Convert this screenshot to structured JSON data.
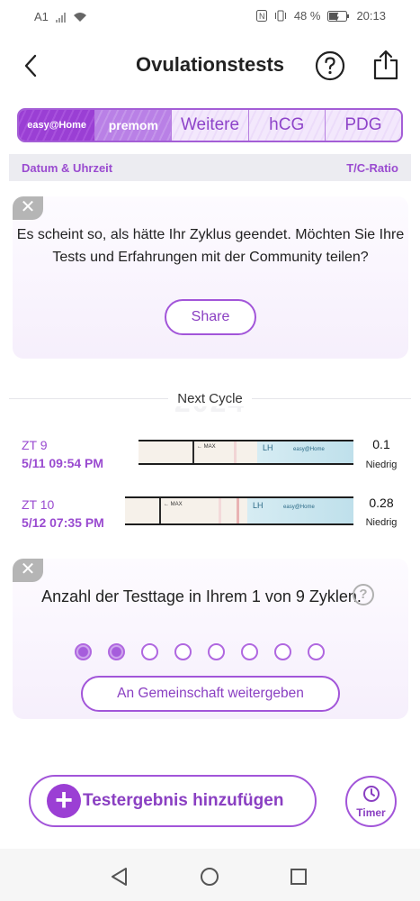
{
  "status_bar": {
    "carrier": "A1",
    "battery": "48 %",
    "time": "20:13"
  },
  "header": {
    "title": "Ovulationstests",
    "back_icon": "chevron-left-icon",
    "help_icon": "question-circle-icon",
    "share_icon": "share-icon"
  },
  "tabs": [
    {
      "label": "easy@Home",
      "active": true
    },
    {
      "label": "premom",
      "active": false
    },
    {
      "label": "Weitere",
      "active": false
    },
    {
      "label": "hCG",
      "active": false
    },
    {
      "label": "PDG",
      "active": false
    }
  ],
  "columns": {
    "left": "Datum & Uhrzeit",
    "right": "T/C-Ratio"
  },
  "cycle_end_card": {
    "message": "Es scheint so, als hätte Ihr Zyklus geendet. Möchten Sie Ihre Tests und Erfahrungen mit der Community teilen?",
    "share_label": "Share"
  },
  "divider": {
    "year": "2024",
    "label": "Next Cycle"
  },
  "tests": [
    {
      "day": "ZT 9",
      "date": "5/11   09:54 PM",
      "ratio": "0.1",
      "level": "Niedrig"
    },
    {
      "day": "ZT 10",
      "date": "5/12   07:35 PM",
      "ratio": "0.28",
      "level": "Niedrig"
    }
  ],
  "strip_text": {
    "max": "← MAX",
    "lh": "LH",
    "brand": "easy@Home"
  },
  "testing_days_card": {
    "message": "Anzahl der Testtage in Ihrem 1 von 9 Zyklen.",
    "help": "?",
    "dots_total": 8,
    "dots_filled": 2,
    "community_label": "An Gemeinschaft weitergeben"
  },
  "actions": {
    "add_label": "Testergebnis hinzufügen",
    "add_icon": "+",
    "timer_label": "Timer"
  },
  "colors": {
    "accent": "#9b3fd4",
    "accent_text": "#8a3fc2"
  }
}
